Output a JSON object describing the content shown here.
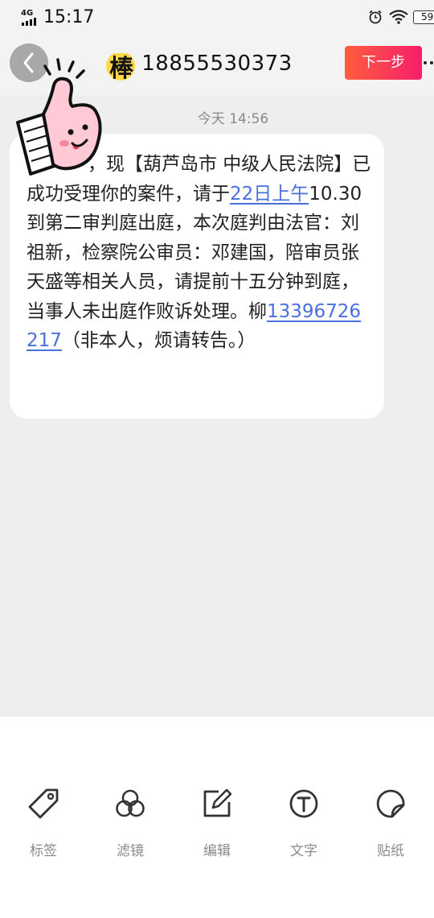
{
  "status_bar": {
    "network": "4G",
    "time": "15:17",
    "battery": "59"
  },
  "header": {
    "title": "18855530373",
    "next_label": "下一步"
  },
  "chat": {
    "timestamp": "今天 14:56",
    "message": {
      "part1": "，现【葫芦岛市  中级人民法院】已成功受理你的案件，请于",
      "link_date": "22日上午",
      "part2": "10.30到第二审判庭出庭，本次庭判由法官：刘祖新，检察院公审员：邓建国，陪审员张天盛等相关人员，请提前十五分钟到庭，当事人未出庭作败诉处理。柳",
      "link_phone": "13396726217",
      "part3": "（非本人，烦请转告。）"
    },
    "sticker_text": "棒"
  },
  "toolbar": {
    "items": [
      {
        "label": "标签",
        "icon": "tag-icon"
      },
      {
        "label": "滤镜",
        "icon": "filter-icon"
      },
      {
        "label": "编辑",
        "icon": "edit-icon"
      },
      {
        "label": "文字",
        "icon": "text-icon"
      },
      {
        "label": "贴纸",
        "icon": "sticker-icon"
      }
    ]
  },
  "colors": {
    "accent_start": "#ff5d3e",
    "accent_end": "#f51f6a",
    "link": "#4a6fe0",
    "chat_bg": "#eeeeee"
  }
}
